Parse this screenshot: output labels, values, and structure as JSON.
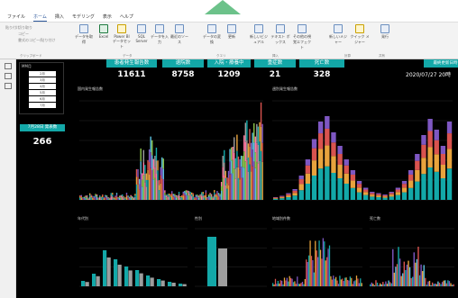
{
  "tabs": [
    "ファイル",
    "ホーム",
    "挿入",
    "モデリング",
    "表示",
    "ヘルプ"
  ],
  "ribbon": {
    "buttons": [
      {
        "label": "データを取得"
      },
      {
        "label": "Excel"
      },
      {
        "label": "Power BI データセット"
      },
      {
        "label": "SQL Server"
      },
      {
        "label": "データを入力"
      },
      {
        "label": "最近のソース"
      },
      {
        "label": "データの変換"
      },
      {
        "label": "更新"
      },
      {
        "label": "新しいビジュアル"
      },
      {
        "label": "テキスト ボックス"
      },
      {
        "label": "その他の視覚エフェクト"
      },
      {
        "label": "新しいメジャー"
      },
      {
        "label": "クイック メジャー"
      },
      {
        "label": "発行"
      }
    ],
    "small_items": [
      "貼り付け",
      "切り取り",
      "コピー",
      "書式のコピー/貼り付け"
    ],
    "groups": [
      "クリップボード",
      "データ",
      "クエリ",
      "挿入",
      "計算",
      "共有"
    ]
  },
  "slicer": {
    "title": "MM月",
    "items": [
      "2月",
      "3月",
      "4月",
      "5月",
      "6月",
      "7月"
    ]
  },
  "kpis": [
    {
      "label": "患者発生報告数",
      "value": "11611"
    },
    {
      "label": "退院数",
      "value": "8758"
    },
    {
      "label": "入院・療養中",
      "value": "1209"
    },
    {
      "label": "重症数",
      "value": "21"
    },
    {
      "label": "死亡数",
      "value": "328"
    }
  ],
  "date_label": "最終更新日時",
  "date_value": "2020/07/27 20時",
  "side_kpi": {
    "label": "7月28日 発表数",
    "value": "266"
  },
  "panels": {
    "daily": "国内発生報告数",
    "weekly": "週別発生報告数",
    "age": "年代別",
    "gender": "性別",
    "region": "地域別件数",
    "death": "死亡数"
  },
  "colors": {
    "accent": "#13a8a8",
    "canvas": "#000000",
    "ribbon": "#f3f3f3",
    "arrow": "#6cc28a"
  }
}
